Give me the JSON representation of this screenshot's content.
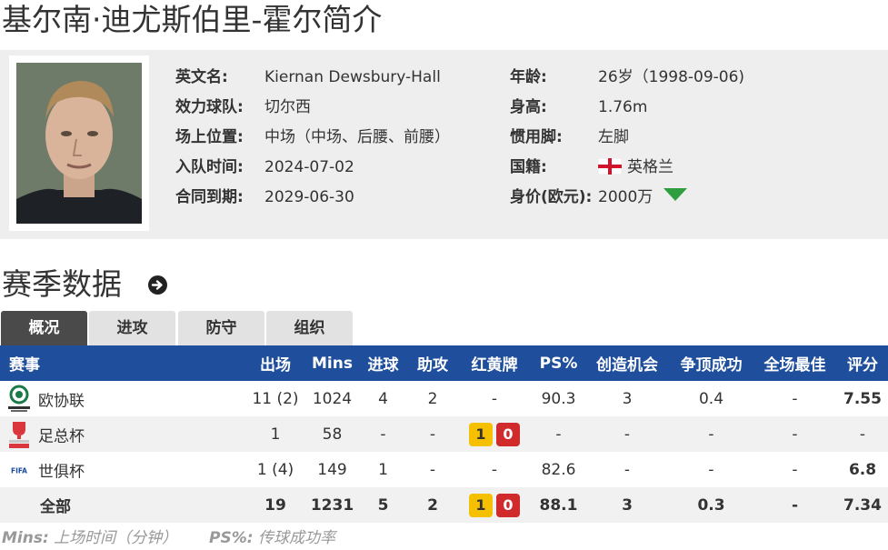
{
  "page_title": "基尔南·迪尤斯伯里-霍尔简介",
  "profile": {
    "fields_left": [
      {
        "label": "英文名:",
        "value": "Kiernan Dewsbury-Hall"
      },
      {
        "label": "效力球队:",
        "value": "切尔西"
      },
      {
        "label": "场上位置:",
        "value": "中场（中场、后腰、前腰）"
      },
      {
        "label": "入队时间:",
        "value": "2024-07-02"
      },
      {
        "label": "合同到期:",
        "value": "2029-06-30"
      }
    ],
    "fields_right": [
      {
        "label": "年龄:",
        "value": "26岁（1998-09-06)"
      },
      {
        "label": "身高:",
        "value": "1.76m"
      },
      {
        "label": "惯用脚:",
        "value": "左脚"
      },
      {
        "label": "国籍:",
        "value": "英格兰",
        "icon": "england-flag-icon"
      },
      {
        "label": "身价(欧元):",
        "value": "2000万",
        "icon": "value-down-triangle-icon"
      }
    ],
    "trend_color": "#2e9e3e"
  },
  "season": {
    "title": "赛季数据",
    "arrow_icon": "circle-arrow-right-icon",
    "tabs": [
      "概况",
      "进攻",
      "防守",
      "组织"
    ],
    "active_tab": 0,
    "columns": [
      "赛事",
      "出场",
      "Mins",
      "进球",
      "助攻",
      "红黄牌",
      "PS%",
      "创造机会",
      "争顶成功",
      "全场最佳",
      "评分"
    ],
    "rows": [
      {
        "competition": "欧协联",
        "logo": "uefa-conference-league-logo-icon",
        "apps": "11 (2)",
        "mins": "1024",
        "goals": "4",
        "assists": "2",
        "cards": "-",
        "ps": "90.3",
        "chances": "3",
        "aerials": "0.4",
        "motm": "-",
        "rating": "7.55"
      },
      {
        "competition": "足总杯",
        "logo": "fa-cup-logo-icon",
        "apps": "1",
        "mins": "58",
        "goals": "-",
        "assists": "-",
        "yellow": "1",
        "red": "0",
        "ps": "-",
        "chances": "-",
        "aerials": "-",
        "motm": "-",
        "rating": "-"
      },
      {
        "competition": "世俱杯",
        "logo": "fifa-logo-icon",
        "apps": "1 (4)",
        "mins": "149",
        "goals": "1",
        "assists": "-",
        "cards": "-",
        "ps": "82.6",
        "chances": "-",
        "aerials": "-",
        "motm": "-",
        "rating": "6.8"
      }
    ],
    "total": {
      "competition": "全部",
      "apps": "19",
      "mins": "1231",
      "goals": "5",
      "assists": "2",
      "yellow": "1",
      "red": "0",
      "ps": "88.1",
      "chances": "3",
      "aerials": "0.3",
      "motm": "-",
      "rating": "7.34"
    },
    "rating_color": "#e2661b",
    "header_color": "#1f4f9c"
  },
  "footnotes": [
    {
      "key": "Mins:",
      "text": "上场时间（分钟）"
    },
    {
      "key": "PS%:",
      "text": "传球成功率"
    }
  ]
}
